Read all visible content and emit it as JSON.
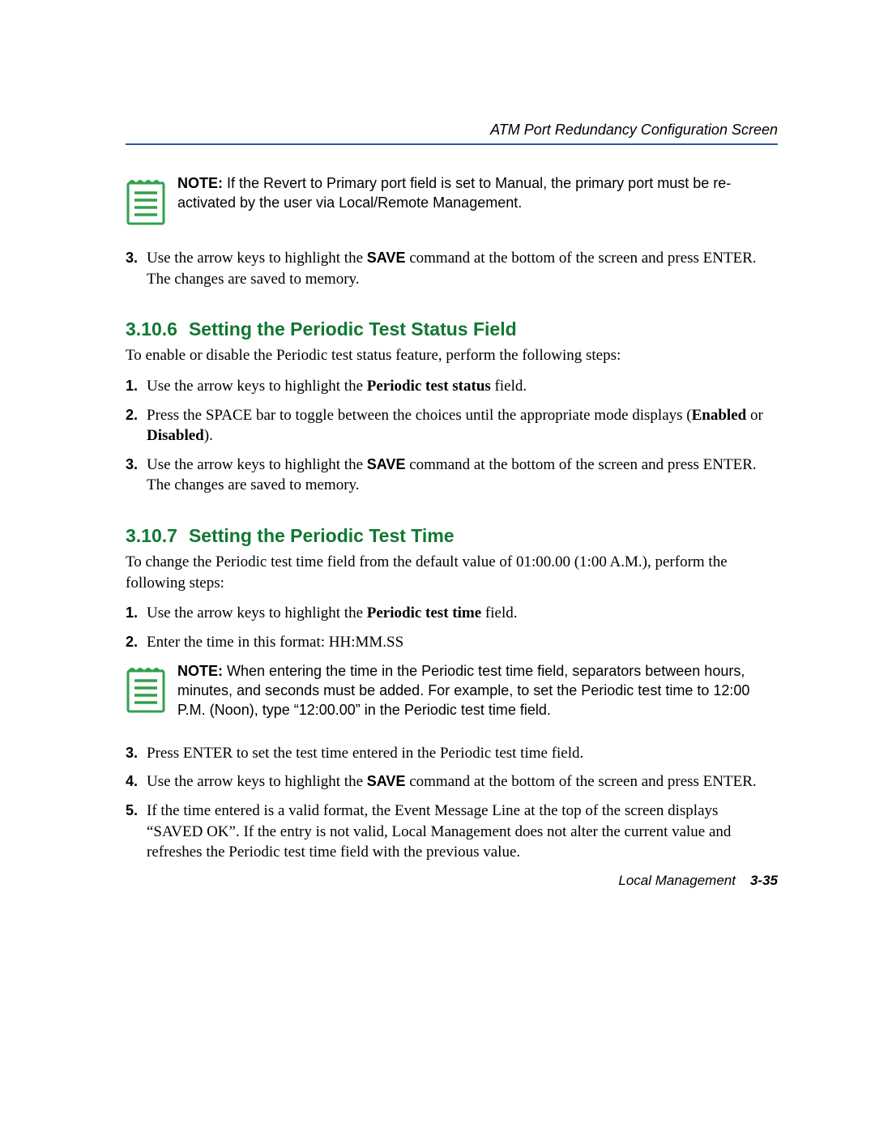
{
  "header": {
    "title": "ATM Port Redundancy Configuration Screen"
  },
  "note1": {
    "bold": "NOTE:",
    "text": "  If the Revert to Primary port field is set to Manual, the primary port must be re-activated by the user via Local/Remote Management."
  },
  "preList": {
    "items": [
      {
        "num": "3.",
        "pre": "Use the arrow keys to highlight the ",
        "bold": "SAVE",
        "post": " command at the bottom of the screen and press ENTER. The changes are saved to memory."
      }
    ]
  },
  "section1": {
    "num": "3.10.6",
    "title": "Setting the Periodic Test Status Field",
    "intro": "To enable or disable the Periodic test status feature, perform the following steps:",
    "items": [
      {
        "num": "1.",
        "pre": "Use the arrow keys to highlight the ",
        "bold": "Periodic test status",
        "post": " field."
      },
      {
        "num": "2.",
        "pre": "Press the SPACE bar to toggle between the choices until the appropriate mode displays (",
        "bold": "Enabled",
        "mid": " or ",
        "bold2": "Disabled",
        "post": ")."
      },
      {
        "num": "3.",
        "pre": "Use the arrow keys to highlight the ",
        "bold": "SAVE",
        "post": " command at the bottom of the screen and press ENTER. The changes are saved to memory."
      }
    ]
  },
  "section2": {
    "num": "3.10.7",
    "title": "Setting the Periodic Test Time",
    "intro": "To change the Periodic test time field from the default value of 01:00.00 (1:00 A.M.), perform the following steps:",
    "itemsA": [
      {
        "num": "1.",
        "pre": "Use the arrow keys to highlight the ",
        "bold": "Periodic test time",
        "post": " field."
      },
      {
        "num": "2.",
        "pre": "Enter the time in this format: HH:MM.SS",
        "bold": "",
        "post": ""
      }
    ],
    "note": {
      "bold": "NOTE:",
      "text": "  When entering the time in the Periodic test time field, separators between hours, minutes, and seconds must be added. For example, to set the Periodic test time to 12:00 P.M. (Noon), type “12:00.00” in the Periodic test time field."
    },
    "itemsB": [
      {
        "num": "3.",
        "pre": "Press ENTER to set the test time entered in the Periodic test time field.",
        "bold": "",
        "post": ""
      },
      {
        "num": "4.",
        "pre": "Use the arrow keys to highlight the ",
        "bold": "SAVE",
        "post": " command at the bottom of the screen and press ENTER."
      },
      {
        "num": "5.",
        "pre": "If the time entered is a valid format, the Event Message Line at the top of the screen displays “SAVED OK”. If the entry is not valid, Local Management does not alter the current value and refreshes the Periodic test time field with the previous value.",
        "bold": "",
        "post": ""
      }
    ]
  },
  "footer": {
    "label": "Local Management",
    "page": "3-35"
  }
}
